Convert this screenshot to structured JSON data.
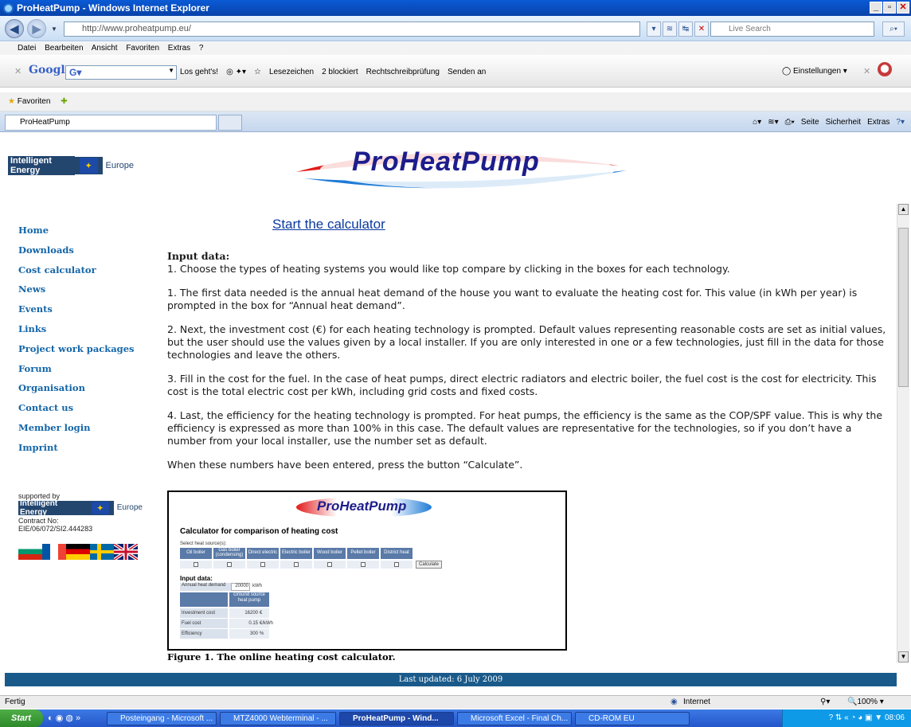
{
  "window": {
    "title": "ProHeatPump - Windows Internet Explorer",
    "address": "http://www.proheatpump.eu/",
    "search_placeholder": "Live Search"
  },
  "menu": [
    "Datei",
    "Bearbeiten",
    "Ansicht",
    "Favoriten",
    "Extras",
    "?"
  ],
  "google_toolbar": {
    "brand": "Google",
    "go_label": "Los geht's!",
    "bookmarks": "Lesezeichen",
    "blocked": "2 blockiert",
    "spellcheck": "Rechtschreibprüfung",
    "send": "Senden an",
    "settings": "Einstellungen"
  },
  "favorites_label": "Favoriten",
  "tab_title": "ProHeatPump",
  "command_bar": [
    "Seite",
    "Sicherheit",
    "Extras"
  ],
  "logos": {
    "intelligent_energy": "Intelligent Energy",
    "europe": "Europe",
    "banner_text": "ProHeatPump"
  },
  "sidebar": {
    "items": [
      "Home",
      "Downloads",
      "Cost calculator",
      "News",
      "Events",
      "Links",
      "Project work packages",
      "Forum",
      "Organisation",
      "Contact us",
      "Member login",
      "Imprint"
    ],
    "supported_by": "supported by",
    "contract_label": "Contract No:",
    "contract_no": "EIE/06/072/SI2.444283"
  },
  "main": {
    "start_link": "Start the calculator",
    "heading": "Input data:",
    "paragraphs": [
      "1. Choose the types of heating systems you would like top compare by clicking in the boxes for each technology.",
      "1. The first data needed is the annual heat demand of the house you want to evaluate the heating cost for. This value (in kWh per year) is prompted in the box for “Annual heat demand”.",
      "2. Next, the investment cost (€) for each heating technology is prompted. Default values representing reasonable costs are set as initial values, but the user should use the values given by a local installer. If you are only interested in one or a few technologies, just fill in the data for those technologies and leave the others.",
      "3. Fill in the cost for the fuel. In the case of heat pumps, direct electric radiators and electric boiler, the fuel cost is the cost for electricity. This cost is the total electric cost per kWh, including grid costs and fixed costs.",
      "4. Last, the efficiency for the heating technology is prompted. For heat pumps, the efficiency is the same as the COP/SPF value. This is why the efficiency is expressed as more than 100% in this case. The default values are representative for the technologies, so if you don’t have a number from your local installer, use the number set as default.",
      "When these numbers have been entered, press the button “Calculate”."
    ],
    "figure_caption": "Figure  1. The online heating cost calculator."
  },
  "figure": {
    "logo": "ProHeatPump",
    "title": "Calculator for comparison of heating cost",
    "select_label": "Select heat source(s):",
    "columns": [
      "Oil boiler",
      "Gas boiler (condensing)",
      "Direct electric",
      "Electric boiler",
      "Wood boiler",
      "Pellet boiler",
      "District heat"
    ],
    "calculate": "Calculate",
    "input_label": "Input data:",
    "annual_label": "Annual heat demand",
    "annual_value": "20000",
    "annual_unit": "kWh",
    "tech_col": "Ground source heat pump",
    "rows": [
      {
        "label": "Investment cost",
        "value": "16200",
        "unit": "€"
      },
      {
        "label": "Fuel cost",
        "value": "0.15",
        "unit": "€/kWh"
      },
      {
        "label": "Efficiency",
        "value": "300",
        "unit": "%"
      }
    ]
  },
  "footer": "Last updated: 6 July 2009",
  "status": {
    "left": "Fertig",
    "zone": "Internet",
    "zoom": "100%"
  },
  "taskbar": {
    "start": "Start",
    "tasks": [
      "Posteingang - Microsoft ...",
      "MTZ4000 Webterminal - ...",
      "ProHeatPump - Wind...",
      "Microsoft Excel - Final Ch...",
      "CD-ROM EU"
    ],
    "clock": "08:06"
  }
}
